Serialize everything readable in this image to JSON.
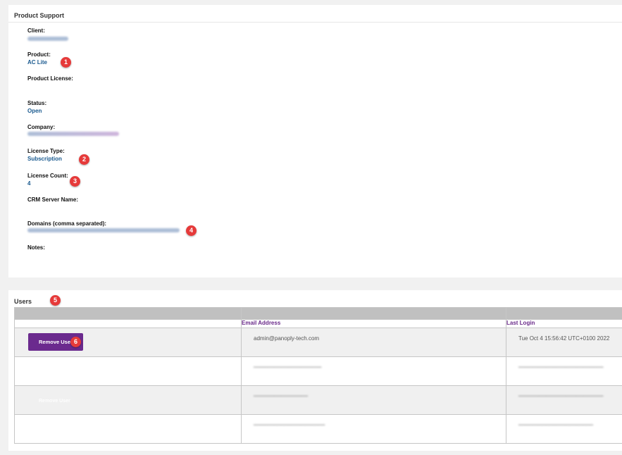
{
  "support": {
    "title": "Product Support",
    "fields": {
      "client_label": "Client:",
      "product_label": "Product:",
      "product_value": "AC Lite",
      "product_license_label": "Product License:",
      "status_label": "Status:",
      "status_value": "Open",
      "company_label": "Company:",
      "license_type_label": "License Type:",
      "license_type_value": "Subscription",
      "license_count_label": "License Count:",
      "license_count_value": "4",
      "crm_server_label": "CRM Server Name:",
      "domains_label": "Domains (comma separated):",
      "notes_label": "Notes:"
    }
  },
  "users": {
    "title": "Users",
    "columns": [
      "Email Address",
      "Last Login"
    ],
    "remove_label": "Remove User",
    "rows": [
      {
        "email": "admin@panoply-tech.com",
        "last_login": "Tue Oct 4 15:56:42 UTC+0100 2022"
      },
      {
        "email": "",
        "last_login": ""
      },
      {
        "email": "",
        "last_login": ""
      },
      {
        "email": "",
        "last_login": ""
      }
    ]
  },
  "badges": [
    "1",
    "2",
    "3",
    "4",
    "5",
    "6"
  ],
  "colors": {
    "value_blue": "#1a5a8f",
    "header_purple": "#6a2a8a",
    "button_purple": "#6b2a8e",
    "badge_red": "#e63a3a"
  }
}
